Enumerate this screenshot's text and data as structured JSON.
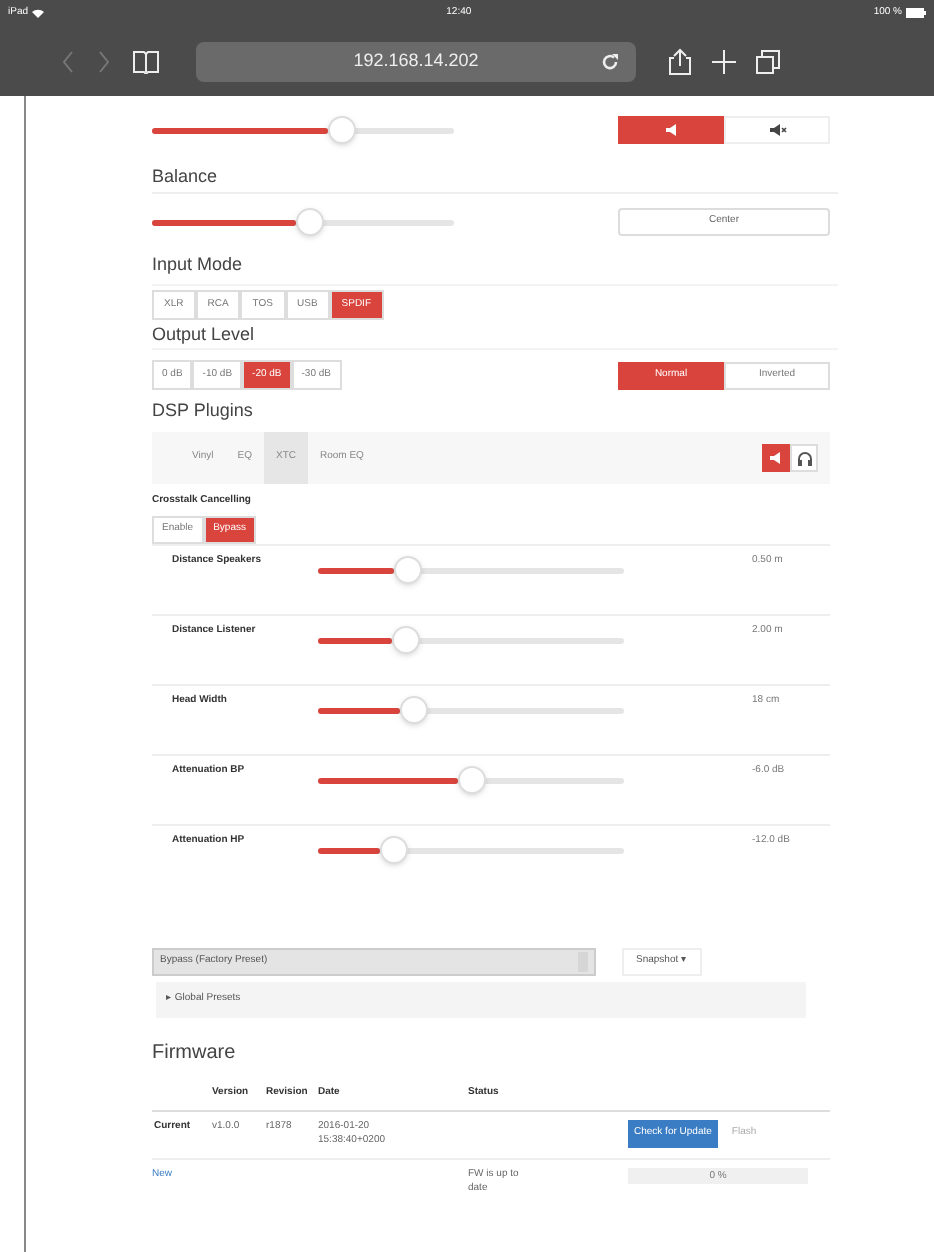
{
  "status_bar": {
    "device": "iPad",
    "time": "12:40",
    "battery": "100 %"
  },
  "browser": {
    "url": "192.168.14.202"
  },
  "volume": {
    "level": 0.58,
    "buttons": [
      {
        "kind": "speaker",
        "selected": true
      },
      {
        "kind": "mute",
        "selected": false
      }
    ]
  },
  "balance": {
    "label": "Balance",
    "level": 0.48,
    "button": "Center"
  },
  "input_mode": {
    "label": "Input Mode",
    "options": [
      {
        "label": "XLR",
        "selected": false
      },
      {
        "label": "RCA",
        "selected": false
      },
      {
        "label": "TOS",
        "selected": false
      },
      {
        "label": "USB",
        "selected": false
      },
      {
        "label": "SPDIF",
        "selected": true
      }
    ]
  },
  "output_level": {
    "label": "Output Level",
    "options": [
      {
        "label": "0 dB",
        "selected": false
      },
      {
        "label": "-10 dB",
        "selected": false
      },
      {
        "label": "-20 dB",
        "selected": true
      },
      {
        "label": "-30 dB",
        "selected": false
      }
    ],
    "phase": [
      {
        "label": "Normal",
        "selected": true
      },
      {
        "label": "Inverted",
        "selected": false
      }
    ]
  },
  "dsp_plugins": {
    "label": "DSP Plugins",
    "tabs": [
      {
        "label": "Vinyl",
        "selected": false
      },
      {
        "label": "EQ",
        "selected": false
      },
      {
        "label": "XTC",
        "selected": true
      },
      {
        "label": "Room EQ",
        "selected": false
      }
    ],
    "outputs": [
      {
        "kind": "speaker",
        "selected": true
      },
      {
        "kind": "headphones",
        "selected": false
      }
    ]
  },
  "crosstalk": {
    "label": "Crosstalk Cancelling",
    "modes": [
      {
        "label": "Enable",
        "selected": false
      },
      {
        "label": "Bypass",
        "selected": true
      }
    ],
    "params": [
      {
        "name": "Distance Speakers",
        "level": 0.25,
        "reading": "0.50 m"
      },
      {
        "name": "Distance Listener",
        "level": 0.24,
        "reading": "2.00 m"
      },
      {
        "name": "Head Width",
        "level": 0.27,
        "reading": "18 cm"
      },
      {
        "name": "Attenuation BP",
        "level": 0.46,
        "reading": "-6.0 dB"
      },
      {
        "name": "Attenuation HP",
        "level": 0.2,
        "reading": "-12.0 dB"
      }
    ]
  },
  "presets": {
    "value": "Bypass (Factory Preset)",
    "snapshot": "Snapshot ▾",
    "global": "▸ Global Presets"
  },
  "firmware": {
    "title": "Firmware",
    "columns": [
      "Version",
      "Revision",
      "Date",
      "Status"
    ],
    "current": {
      "label": "Current",
      "version": "v1.0.0",
      "revision": "r1878",
      "date": "2016-01-20 15:38:40+0200",
      "check": "Check for Update",
      "flash": "Flash"
    },
    "new": {
      "label": "New",
      "status": "FW is up to date",
      "progress": "0 %"
    }
  }
}
